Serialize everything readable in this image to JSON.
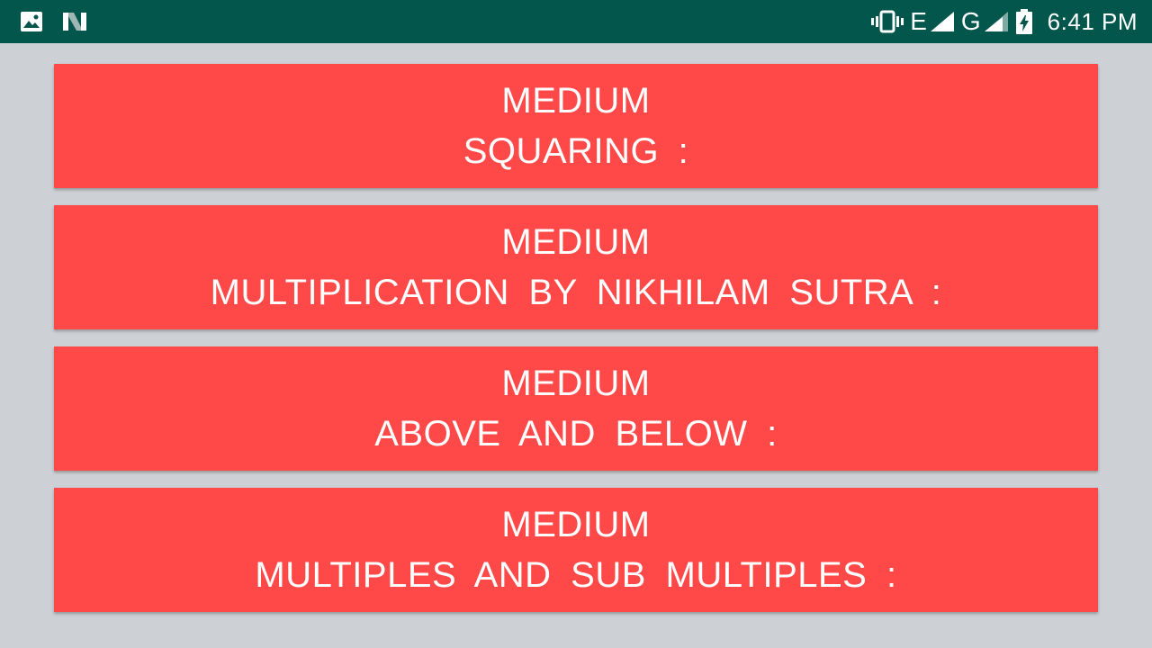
{
  "status_bar": {
    "left_icons": [
      "image-notification-icon",
      "n-notification-icon"
    ],
    "right_icons": [
      "vibrate-icon",
      "signal-e-icon",
      "signal-g-icon",
      "battery-charging-icon"
    ],
    "network_1": "E",
    "network_2": "G",
    "time": "6:41 PM",
    "bg_color": "#02564b"
  },
  "cards": [
    {
      "level": "MEDIUM",
      "topic": "SQUARING :"
    },
    {
      "level": "MEDIUM",
      "topic": "MULTIPLICATION BY NIKHILAM SUTRA :"
    },
    {
      "level": "MEDIUM",
      "topic": "ABOVE AND BELOW :"
    },
    {
      "level": "MEDIUM",
      "topic": "MULTIPLES AND SUB MULTIPLES :"
    }
  ],
  "colors": {
    "card_bg": "#ff4949",
    "page_bg": "#cdd0d4",
    "text": "#ffffff"
  }
}
